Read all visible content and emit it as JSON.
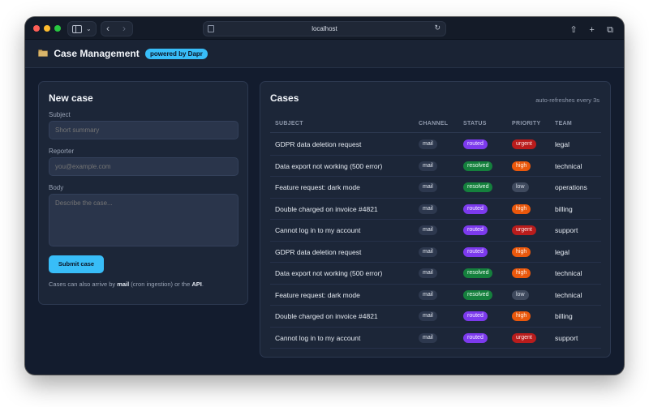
{
  "browser": {
    "url": "localhost"
  },
  "app": {
    "title": "Case Management",
    "badge": "powered by Dapr"
  },
  "new_case": {
    "title": "New case",
    "subject_label": "Subject",
    "subject_placeholder": "Short summary",
    "reporter_label": "Reporter",
    "reporter_placeholder": "you@example.com",
    "body_label": "Body",
    "body_placeholder": "Describe the case...",
    "submit_label": "Submit case",
    "hint_prefix": "Cases can also arrive by ",
    "hint_mail": "mail",
    "hint_middle": " (cron ingestion) or the ",
    "hint_api": "API",
    "hint_suffix": "."
  },
  "cases": {
    "title": "Cases",
    "refresh_note": "auto-refreshes every 3s",
    "columns": [
      "SUBJECT",
      "CHANNEL",
      "STATUS",
      "PRIORITY",
      "TEAM"
    ],
    "rows": [
      {
        "subject": "GDPR data deletion request",
        "channel": "mail",
        "status": "routed",
        "priority": "urgent",
        "team": "legal"
      },
      {
        "subject": "Data export not working (500 error)",
        "channel": "mail",
        "status": "resolved",
        "priority": "high",
        "team": "technical"
      },
      {
        "subject": "Feature request: dark mode",
        "channel": "mail",
        "status": "resolved",
        "priority": "low",
        "team": "operations"
      },
      {
        "subject": "Double charged on invoice #4821",
        "channel": "mail",
        "status": "routed",
        "priority": "high",
        "team": "billing"
      },
      {
        "subject": "Cannot log in to my account",
        "channel": "mail",
        "status": "routed",
        "priority": "urgent",
        "team": "support"
      },
      {
        "subject": "GDPR data deletion request",
        "channel": "mail",
        "status": "routed",
        "priority": "high",
        "team": "legal"
      },
      {
        "subject": "Data export not working (500 error)",
        "channel": "mail",
        "status": "resolved",
        "priority": "high",
        "team": "technical"
      },
      {
        "subject": "Feature request: dark mode",
        "channel": "mail",
        "status": "resolved",
        "priority": "low",
        "team": "technical"
      },
      {
        "subject": "Double charged on invoice #4821",
        "channel": "mail",
        "status": "routed",
        "priority": "high",
        "team": "billing"
      },
      {
        "subject": "Cannot log in to my account",
        "channel": "mail",
        "status": "routed",
        "priority": "urgent",
        "team": "support"
      }
    ]
  },
  "colors": {
    "accent": "#38bdf8",
    "routed": "#7c3aed",
    "resolved": "#15803d",
    "urgent": "#b91c1c",
    "high": "#ea580c",
    "low": "#3f4a5e"
  }
}
